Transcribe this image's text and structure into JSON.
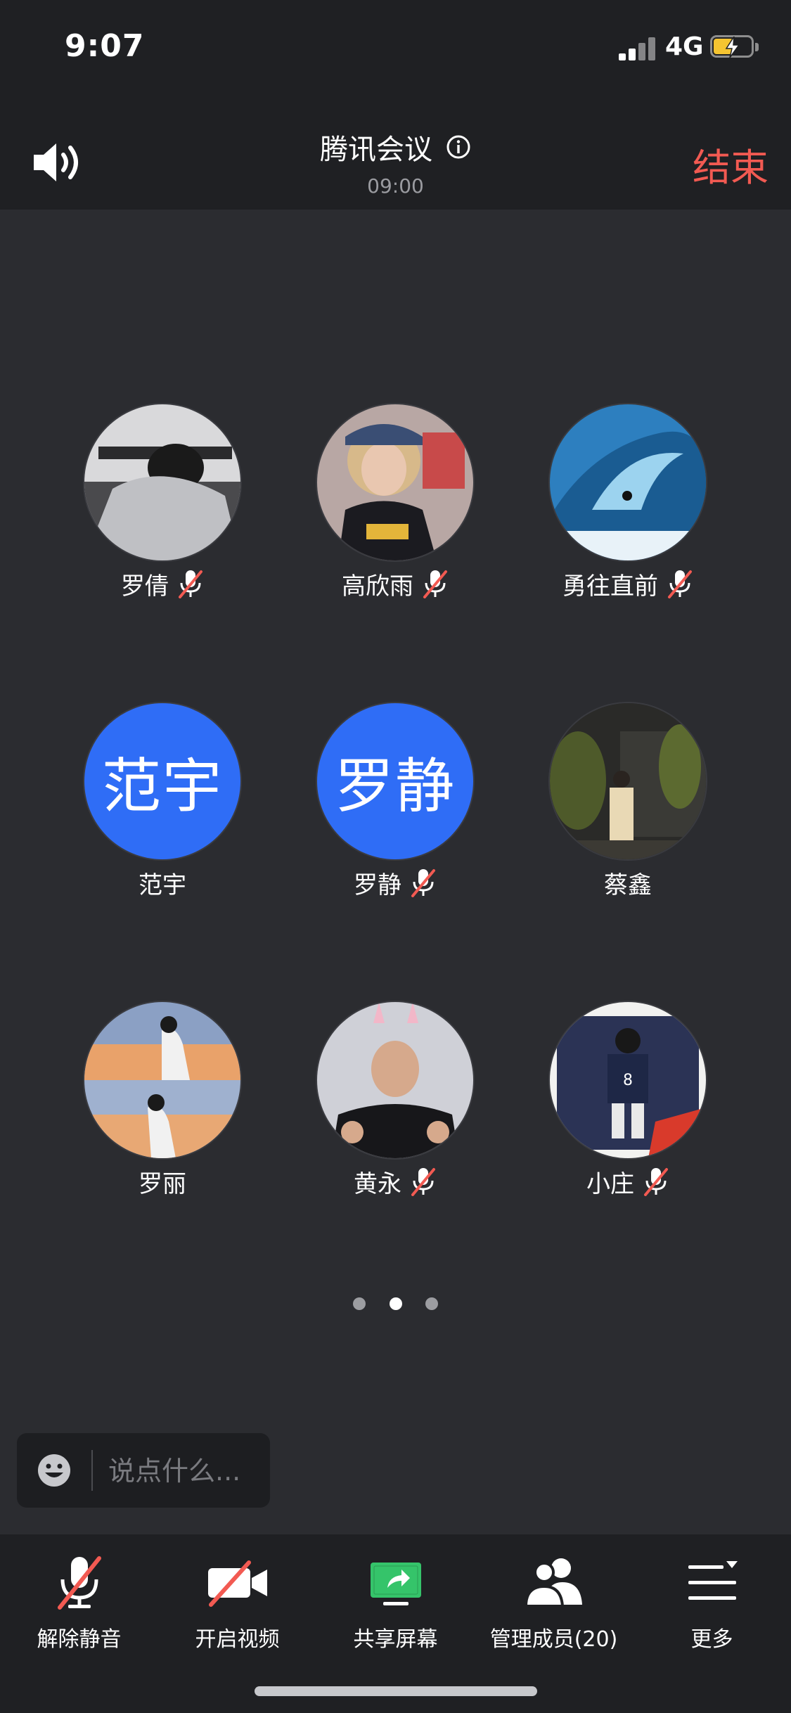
{
  "status_bar": {
    "time": "9:07",
    "network": "4G"
  },
  "header": {
    "title": "腾讯会议",
    "time": "09:00",
    "end_label": "结束"
  },
  "participants": [
    {
      "name": "罗倩",
      "muted": true
    },
    {
      "name": "高欣雨",
      "muted": true
    },
    {
      "name": "勇往直前",
      "muted": true
    },
    {
      "name": "范宇",
      "initials": "范宇",
      "muted": false
    },
    {
      "name": "罗静",
      "initials": "罗静",
      "muted": true
    },
    {
      "name": "蔡鑫",
      "muted": false
    },
    {
      "name": "罗丽",
      "muted": false
    },
    {
      "name": "黄永",
      "muted": true
    },
    {
      "name": "小庄",
      "muted": true
    }
  ],
  "pagination": {
    "current": 2,
    "total": 3
  },
  "chat": {
    "placeholder": "说点什么..."
  },
  "toolbar": {
    "unmute_label": "解除静音",
    "video_label": "开启视频",
    "share_label": "共享屏幕",
    "members_label": "管理成员(20)",
    "more_label": "更多"
  },
  "colors": {
    "accent_blue": "#2f6df6",
    "end_red": "#f25a52",
    "share_green": "#35c46a",
    "battery_yellow": "#f5c431"
  }
}
